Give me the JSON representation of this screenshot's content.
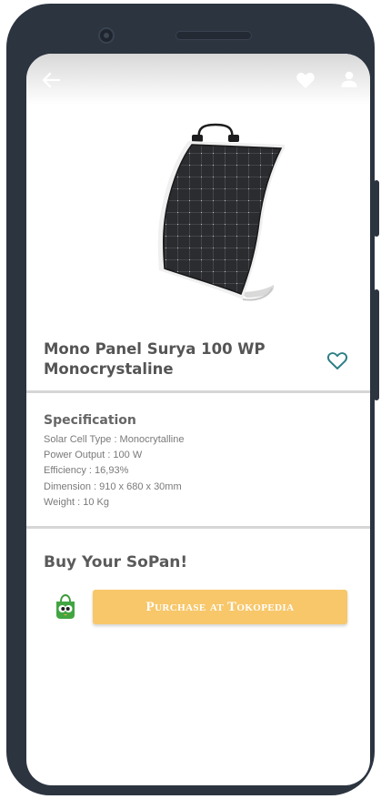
{
  "header": {
    "back_icon": "arrow-left-icon",
    "favorite_icon": "heart-icon",
    "profile_icon": "user-icon"
  },
  "product": {
    "title": "Mono Panel Surya 100 WP Monocrystaline",
    "image_icon": "flexible-solar-panel-image",
    "favorite_icon": "heart-outline-icon",
    "favorite_color": "#2c7f85"
  },
  "specification": {
    "heading": "Specification",
    "items": [
      "Solar Cell Type : Monocrytalline",
      "Power Output : 100 W",
      "Efficiency : 16,93%",
      "Dimension : 910 x 680 x 30mm",
      "Weight : 10 Kg"
    ]
  },
  "buy": {
    "heading": "Buy Your SoPan!",
    "store_icon": "tokopedia-bag-icon",
    "purchase_label": "Purchase at Tokopedia",
    "button_color": "#f7c76a"
  }
}
